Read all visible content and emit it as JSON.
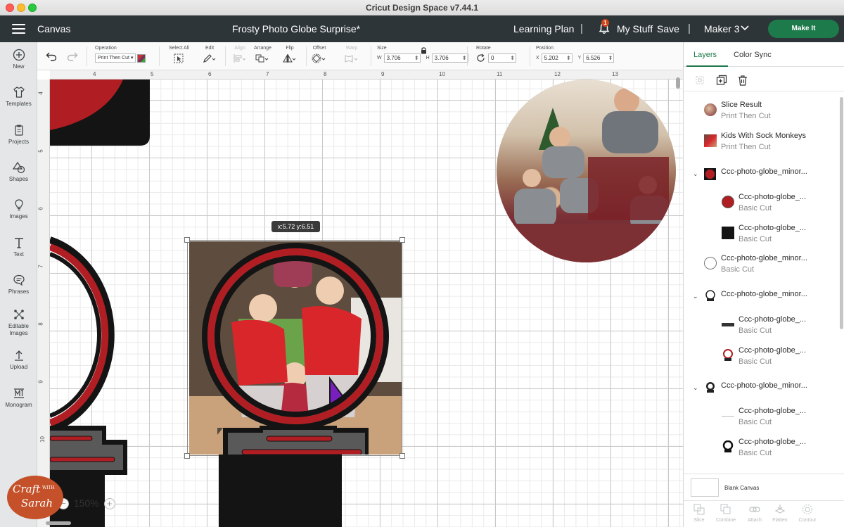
{
  "window": {
    "title": "Cricut Design Space  v7.44.1"
  },
  "header": {
    "section": "Canvas",
    "project_title": "Frosty Photo Globe Surprise*",
    "learning_plan": "Learning Plan",
    "divider": "|",
    "notification_count": "1",
    "my_stuff": "My Stuff",
    "save": "Save",
    "machine": "Maker 3",
    "make_it": "Make It"
  },
  "sidebar": {
    "items": [
      {
        "label": "New",
        "icon": "plus-circle-icon"
      },
      {
        "label": "Templates",
        "icon": "shirt-icon"
      },
      {
        "label": "Projects",
        "icon": "clipboard-icon"
      },
      {
        "label": "Shapes",
        "icon": "shapes-icon"
      },
      {
        "label": "Images",
        "icon": "lightbulb-icon"
      },
      {
        "label": "Text",
        "icon": "text-icon"
      },
      {
        "label": "Phrases",
        "icon": "speech-bubble-icon"
      },
      {
        "label": "Editable Images",
        "icon": "editable-image-icon"
      },
      {
        "label": "Upload",
        "icon": "upload-icon"
      },
      {
        "label": "Monogram",
        "icon": "monogram-icon"
      }
    ]
  },
  "toolbar": {
    "operation_label": "Operation",
    "operation_value": "Print Then Cut",
    "select_all": "Select All",
    "edit": "Edit",
    "align": "Align",
    "arrange": "Arrange",
    "flip": "Flip",
    "offset": "Offset",
    "warp": "Warp",
    "size": "Size",
    "w_label": "W",
    "w_value": "3.706",
    "h_label": "H",
    "h_value": "3.706",
    "rotate": "Rotate",
    "rotate_value": "0",
    "position": "Position",
    "x_label": "X",
    "x_value": "5.202",
    "y_label": "Y",
    "y_value": "6.526"
  },
  "canvas": {
    "ruler_top": [
      "4",
      "5",
      "6",
      "7",
      "8",
      "9",
      "10",
      "11",
      "12",
      "13"
    ],
    "ruler_left": [
      "4",
      "5",
      "6",
      "7",
      "8",
      "9",
      "10"
    ],
    "coord_tooltip": "x:5.72 y:6.51",
    "zoom": "150%",
    "zoom_out": "−",
    "zoom_in": "+"
  },
  "layers_panel": {
    "tabs": [
      "Layers",
      "Color Sync"
    ],
    "items": [
      {
        "name": "Slice Result",
        "op": "Print Then Cut",
        "indent": 0,
        "group": false
      },
      {
        "name": "Kids With Sock Monkeys",
        "op": "Print Then Cut",
        "indent": 0,
        "group": false
      },
      {
        "name": "Ccc-photo-globe_minor...",
        "op": "",
        "indent": 0,
        "group": true
      },
      {
        "name": "Ccc-photo-globe_...",
        "op": "Basic Cut",
        "indent": 1,
        "group": false
      },
      {
        "name": "Ccc-photo-globe_...",
        "op": "Basic Cut",
        "indent": 1,
        "group": false
      },
      {
        "name": "Ccc-photo-globe_minor...",
        "op": "Basic Cut",
        "indent": 0,
        "group": false
      },
      {
        "name": "Ccc-photo-globe_minor...",
        "op": "",
        "indent": 0,
        "group": true
      },
      {
        "name": "Ccc-photo-globe_...",
        "op": "Basic Cut",
        "indent": 1,
        "group": false
      },
      {
        "name": "Ccc-photo-globe_...",
        "op": "Basic Cut",
        "indent": 1,
        "group": false
      },
      {
        "name": "Ccc-photo-globe_minor...",
        "op": "",
        "indent": 0,
        "group": true
      },
      {
        "name": "Ccc-photo-globe_...",
        "op": "Basic Cut",
        "indent": 1,
        "group": false
      },
      {
        "name": "Ccc-photo-globe_...",
        "op": "Basic Cut",
        "indent": 1,
        "group": false
      }
    ],
    "blank_canvas": "Blank Canvas",
    "bottom_tools": [
      "Slice",
      "Combine",
      "Attach",
      "Flatten",
      "Contour"
    ]
  },
  "watermark": {
    "line1": "Craft",
    "line2": "WITH",
    "line3": "Sarah"
  },
  "colors": {
    "header_bg": "#2e3539",
    "make_it_green": "#1d7a4b",
    "globe_red": "#b01e23",
    "globe_black": "#141414",
    "base_gray": "#595959",
    "cursor_purple": "#8a2be2"
  }
}
